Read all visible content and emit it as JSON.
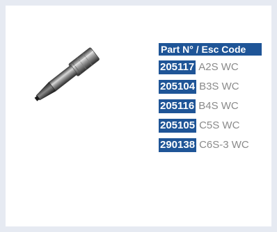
{
  "table": {
    "header": "Part N° / Esc Code",
    "rows": [
      {
        "part_number": "205117",
        "esc_code": "A2S WC"
      },
      {
        "part_number": "205104",
        "esc_code": "B3S WC"
      },
      {
        "part_number": "205116",
        "esc_code": "B4S WC"
      },
      {
        "part_number": "205105",
        "esc_code": "C5S WC"
      },
      {
        "part_number": "290138",
        "esc_code": "C6S-3 WC"
      }
    ]
  },
  "colors": {
    "accent": "#1f5597",
    "code_text": "#8a8a8a",
    "frame": "#e6eaf2"
  }
}
